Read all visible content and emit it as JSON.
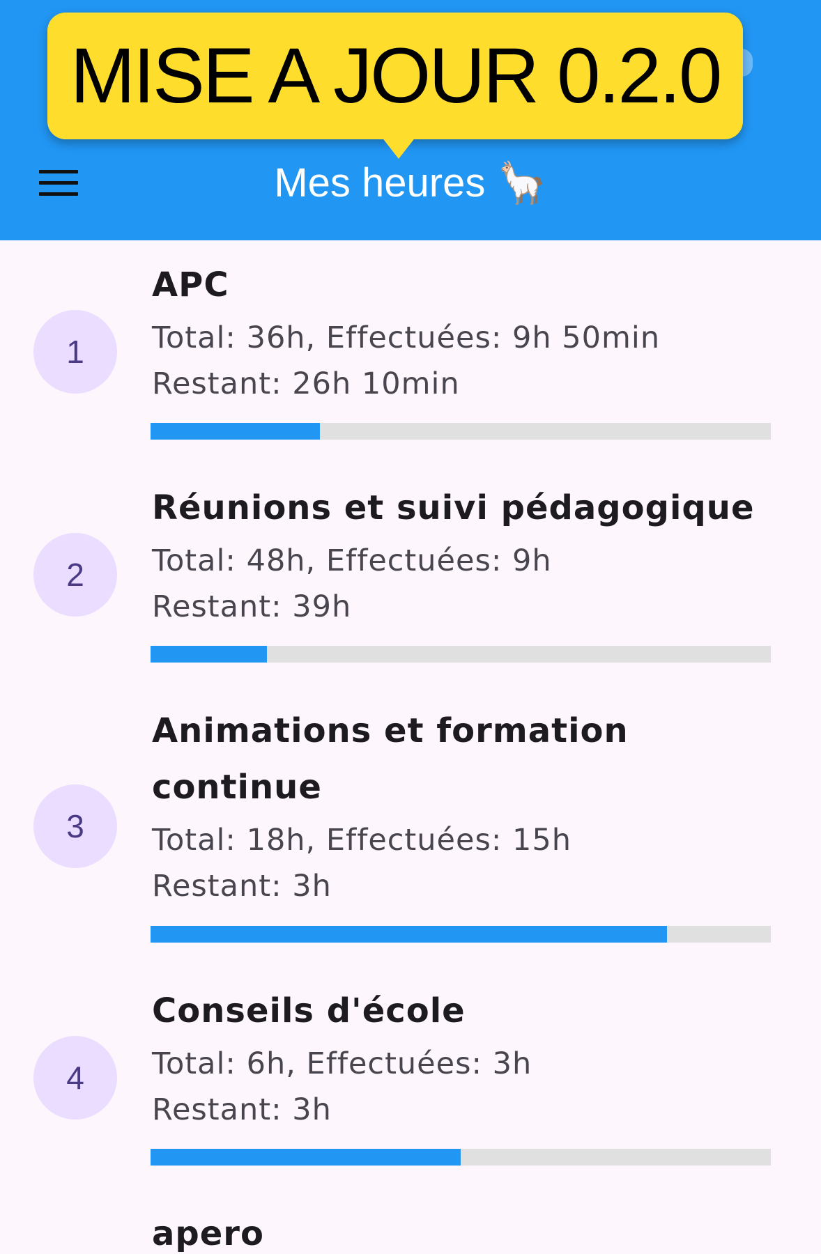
{
  "appbar": {
    "title": "Mes heures 🦙",
    "menu_icon": "hamburger-menu-icon",
    "color": "#2196f3"
  },
  "banner": {
    "text": "MISE A JOUR 0.2.0",
    "color": "#fedd2c"
  },
  "items": [
    {
      "index": "1",
      "title": "APC",
      "total_line": "Total: 36h, Effectuées: 9h 50min",
      "remaining_line": "Restant: 26h 10min",
      "progress": 0.273
    },
    {
      "index": "2",
      "title": "Réunions et suivi pédagogique",
      "total_line": "Total: 48h, Effectuées: 9h",
      "remaining_line": "Restant: 39h",
      "progress": 0.1875
    },
    {
      "index": "3",
      "title_line1": "Animations et formation",
      "title_line2": "continue",
      "total_line": "Total: 18h, Effectuées: 15h",
      "remaining_line": "Restant: 3h",
      "progress": 0.833
    },
    {
      "index": "4",
      "title": "Conseils d'école",
      "total_line": "Total: 6h, Effectuées: 3h",
      "remaining_line": "Restant: 3h",
      "progress": 0.5
    },
    {
      "title": "apero"
    }
  ]
}
